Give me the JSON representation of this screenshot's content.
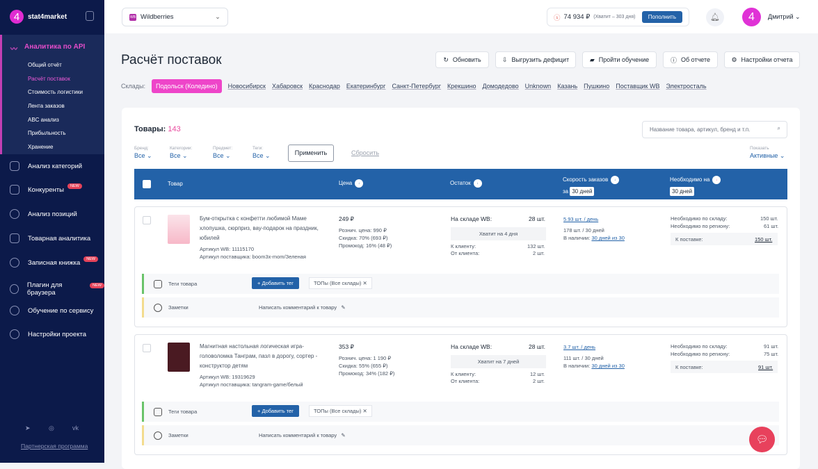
{
  "brand": "stat4market",
  "sidebar": {
    "section": "Аналитика по API",
    "sub": [
      "Общий отчёт",
      "Расчёт поставок",
      "Стоимость логистики",
      "Лента заказов",
      "ABC анализ",
      "Прибыльность",
      "Хранение"
    ],
    "items": [
      {
        "label": "Анализ категорий"
      },
      {
        "label": "Конкуренты",
        "badge": "NEW"
      },
      {
        "label": "Анализ позиций"
      },
      {
        "label": "Товарная аналитика"
      },
      {
        "label": "Записная книжка",
        "badge": "NEW"
      },
      {
        "label": "Плагин для браузера",
        "badge": "NEW"
      },
      {
        "label": "Обучение по сервису"
      },
      {
        "label": "Настройки проекта"
      }
    ],
    "partner": "Партнерская программа"
  },
  "header": {
    "marketplace": "Wildberries",
    "wb": "WB",
    "balance": "74 934 ₽",
    "balance_hint": "(Хватит – 303 дня)",
    "topup": "Пополнить",
    "avatar": "4",
    "user": "Дмитрий"
  },
  "page": {
    "title": "Расчёт поставок",
    "buttons": [
      "Обновить",
      "Выгрузить дефицит",
      "Пройти обучение",
      "Об отчете",
      "Настройки отчета"
    ],
    "wh_label": "Склады:",
    "warehouses": [
      "Подольск (Коледино)",
      "Новосибирск",
      "Хабаровск",
      "Краснодар",
      "Екатеринбург",
      "Санкт-Петербург",
      "Крекшино",
      "Домодедово",
      "Unknown",
      "Казань",
      "Пушкино",
      "Поставщик WB",
      "Электросталь"
    ]
  },
  "list": {
    "title": "Товары:",
    "count": "143",
    "search_placeholder": "Название товара, артикул, бренд и т.п.",
    "filters": [
      {
        "label": "Бренд:",
        "value": "Все"
      },
      {
        "label": "Категории:",
        "value": "Все"
      },
      {
        "label": "Предмет:",
        "value": "Все"
      },
      {
        "label": "Теги:",
        "value": "Все"
      }
    ],
    "apply": "Применить",
    "reset": "Сбросить",
    "show_label": "Показать",
    "show_value": "Активные",
    "cols": {
      "product": "Товар",
      "price": "Цена",
      "stock": "Остаток",
      "speed": "Скорость заказов",
      "speed_for": "за",
      "speed_period": "30 дней",
      "need": "Необходимо на",
      "need_period": "30 дней"
    }
  },
  "products": [
    {
      "name": "Бум-открытка с конфетти любимой Маме хлопушка, сюрприз, вау-подарок на праздник, юбилей",
      "art_wb": "Артикул WB: 11115170",
      "art_sup": "Артикул поставщика: boom3x-mom/Зеленая",
      "price": "249 ₽",
      "retail": "Рознич. цена: 990 ₽",
      "discount": "Скидка: 70% (693 ₽)",
      "promo": "Промокод: 16% (48 ₽)",
      "stock_label": "На складе WB:",
      "stock": "28 шт.",
      "enough": "Хватит на 4 дня",
      "to_client_label": "К клиенту:",
      "to_client": "132 шт.",
      "from_client_label": "От клиента:",
      "from_client": "2 шт.",
      "speed": "5.93 шт. / день",
      "speed30": "178 шт. / 30 дней",
      "avail_label": "В наличии:",
      "avail": "30 дней из 30",
      "need_wh_label": "Необходимо по складу:",
      "need_wh": "150 шт.",
      "need_reg_label": "Необходимо по региону:",
      "need_reg": "61 шт.",
      "supply_label": "К поставке:",
      "supply": "150 шт.",
      "tags_label": "Теги товара",
      "add_tag": "Добавить тег",
      "tag": "ТОПы (Все склады)",
      "notes_label": "Заметки",
      "note_placeholder": "Написать комментарий к товару"
    },
    {
      "name": "Магнитная настольная логическая игра-головоломка Танграм, пазл в дорогу, сортер - конструктор детям",
      "art_wb": "Артикул WB: 19319629",
      "art_sup": "Артикул поставщика: tangram-game/белый",
      "price": "353 ₽",
      "retail": "Рознич. цена: 1 190 ₽",
      "discount": "Скидка: 55% (655 ₽)",
      "promo": "Промокод: 34% (182 ₽)",
      "stock_label": "На складе WB:",
      "stock": "28 шт.",
      "enough": "Хватит на 7 дней",
      "to_client_label": "К клиенту:",
      "to_client": "12 шт.",
      "from_client_label": "От клиента:",
      "from_client": "2 шт.",
      "speed": "3.7 шт. / день",
      "speed30": "111 шт. / 30 дней",
      "avail_label": "В наличии:",
      "avail": "30 дней из 30",
      "need_wh_label": "Необходимо по складу:",
      "need_wh": "91 шт.",
      "need_reg_label": "Необходимо по региону:",
      "need_reg": "75 шт.",
      "supply_label": "К поставке:",
      "supply": "91 шт.",
      "tags_label": "Теги товара",
      "add_tag": "Добавить тег",
      "tag": "ТОПы (Все склады)",
      "notes_label": "Заметки",
      "note_placeholder": "Написать комментарий к товару"
    }
  ]
}
